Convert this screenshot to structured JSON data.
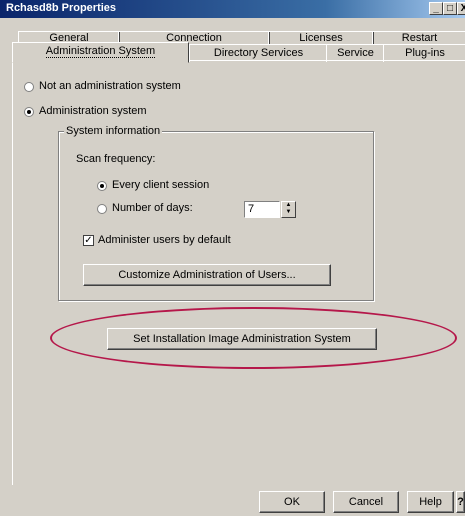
{
  "window": {
    "title": "Rchasd8b Properties"
  },
  "title_buttons": {
    "minimize": "_",
    "maximize": "□",
    "close": "X"
  },
  "tabs": {
    "row1": [
      "General",
      "Connection",
      "Licenses",
      "Restart"
    ],
    "row2": [
      "Administration System",
      "Directory Services",
      "Service",
      "Plug-ins"
    ],
    "active": "Administration System"
  },
  "options": {
    "not_admin": "Not an administration system",
    "admin": "Administration system",
    "selected": "admin"
  },
  "system_info": {
    "legend": "System information",
    "scan_label": "Scan frequency:",
    "every_client": "Every client session",
    "num_days": "Number of days:",
    "days_value": "7",
    "selected": "every_client",
    "administer_label": "Administer users by default",
    "administer_checked": true,
    "customize_button": "Customize Administration of Users..."
  },
  "install_button": "Set Installation Image Administration System",
  "footer": {
    "ok": "OK",
    "cancel": "Cancel",
    "help": "Help",
    "question": "?"
  }
}
